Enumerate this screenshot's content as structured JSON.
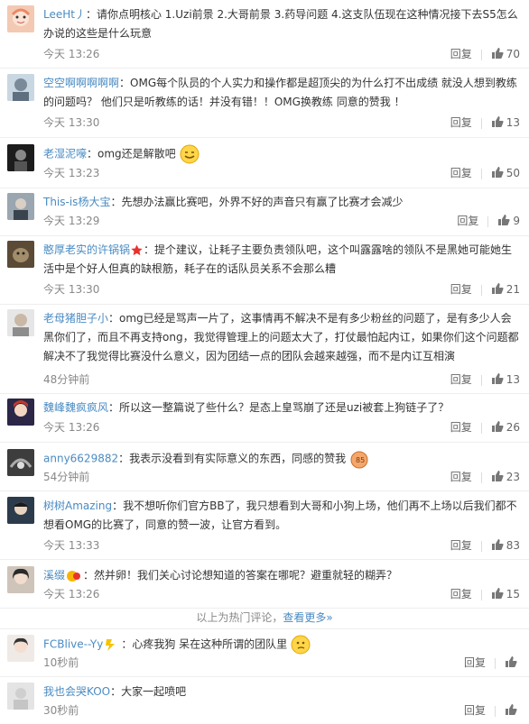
{
  "action_labels": {
    "reply": "回复"
  },
  "hot_divider": {
    "text": "以上为热门评论，",
    "more": "查看更多»"
  },
  "comments": [
    {
      "user": "LeeHt丿",
      "text": "：请你点明核心 1.Uzi前景 2.大哥前景 3.药导问题 4.这支队伍现在这种情况接下去S5怎么办说的这些是什么玩意",
      "time": "今天 13:26",
      "likes": "70"
    },
    {
      "user": "空空啊啊啊啊啊",
      "text": "：OMG每个队员的个人实力和操作都是超顶尖的为什么打不出成绩 就没人想到教练的问题吗？ 他们只是听教练的话！并没有错！！OMG换教练 同意的赞我 ！",
      "time": "今天 13:30",
      "likes": "13"
    },
    {
      "user": "老湿泥嚎",
      "text": "：omg还是解散吧",
      "time": "今天 13:23",
      "likes": "50"
    },
    {
      "user": "This-is杨大宝",
      "text": "：先想办法赢比赛吧，外界不好的声音只有赢了比赛才会减少",
      "time": "今天 13:29",
      "likes": "9"
    },
    {
      "user": "憨厚老实的许锅锅",
      "text": "：提个建议，让耗子主要负责领队吧，这个叫露露啥的领队不是黑她可能她生活中是个好人但真的缺根筋，耗子在的话队员关系不会那么糟",
      "time": "今天 13:30",
      "likes": "21"
    },
    {
      "user": "老母猪胆子小",
      "text": "：omg已经是骂声一片了，这事情再不解决不是有多少粉丝的问题了，是有多少人会黑你们了，而且不再支持ong，我觉得管理上的问题太大了，打仗最怕起内讧，如果你们这个问题都解决不了我觉得比赛没什么意义，因为团结一点的团队会越来越强，而不是内讧互相演",
      "time": "48分钟前",
      "likes": "13"
    },
    {
      "user": "魏峰魏疯疯风",
      "text": "：所以这一整篇说了些什么？是态上皇骂崩了还是uzi被套上狗链子了？",
      "time": "今天 13:26",
      "likes": "26"
    },
    {
      "user": "anny6629882",
      "text": "：我表示没看到有实际意义的东西，同感的赞我",
      "time": "54分钟前",
      "likes": "23"
    },
    {
      "user": "树树Amazing",
      "text": "：我不想听你们官方BB了，我只想看到大哥和小狗上场，他们再不上场以后我们都不想看OMG的比赛了，同意的赞一波，让官方看到。",
      "time": "今天 13:33",
      "likes": "83"
    },
    {
      "user": "溪缀",
      "text": "：然并卵！我们关心讨论想知道的答案在哪呢？避重就轻的糊弄？",
      "time": "今天 13:26",
      "likes": "15"
    },
    {
      "user": "FCBlive--Yy",
      "text": "：心疼我狗 呆在这种所谓的团队里",
      "time": "10秒前",
      "likes": ""
    },
    {
      "user": "我也会哭KOO",
      "text": "：大家一起喷吧",
      "time": "30秒前",
      "likes": ""
    }
  ],
  "colors": {
    "link": "#4a8bc2",
    "text": "#333333",
    "meta": "#888888"
  }
}
